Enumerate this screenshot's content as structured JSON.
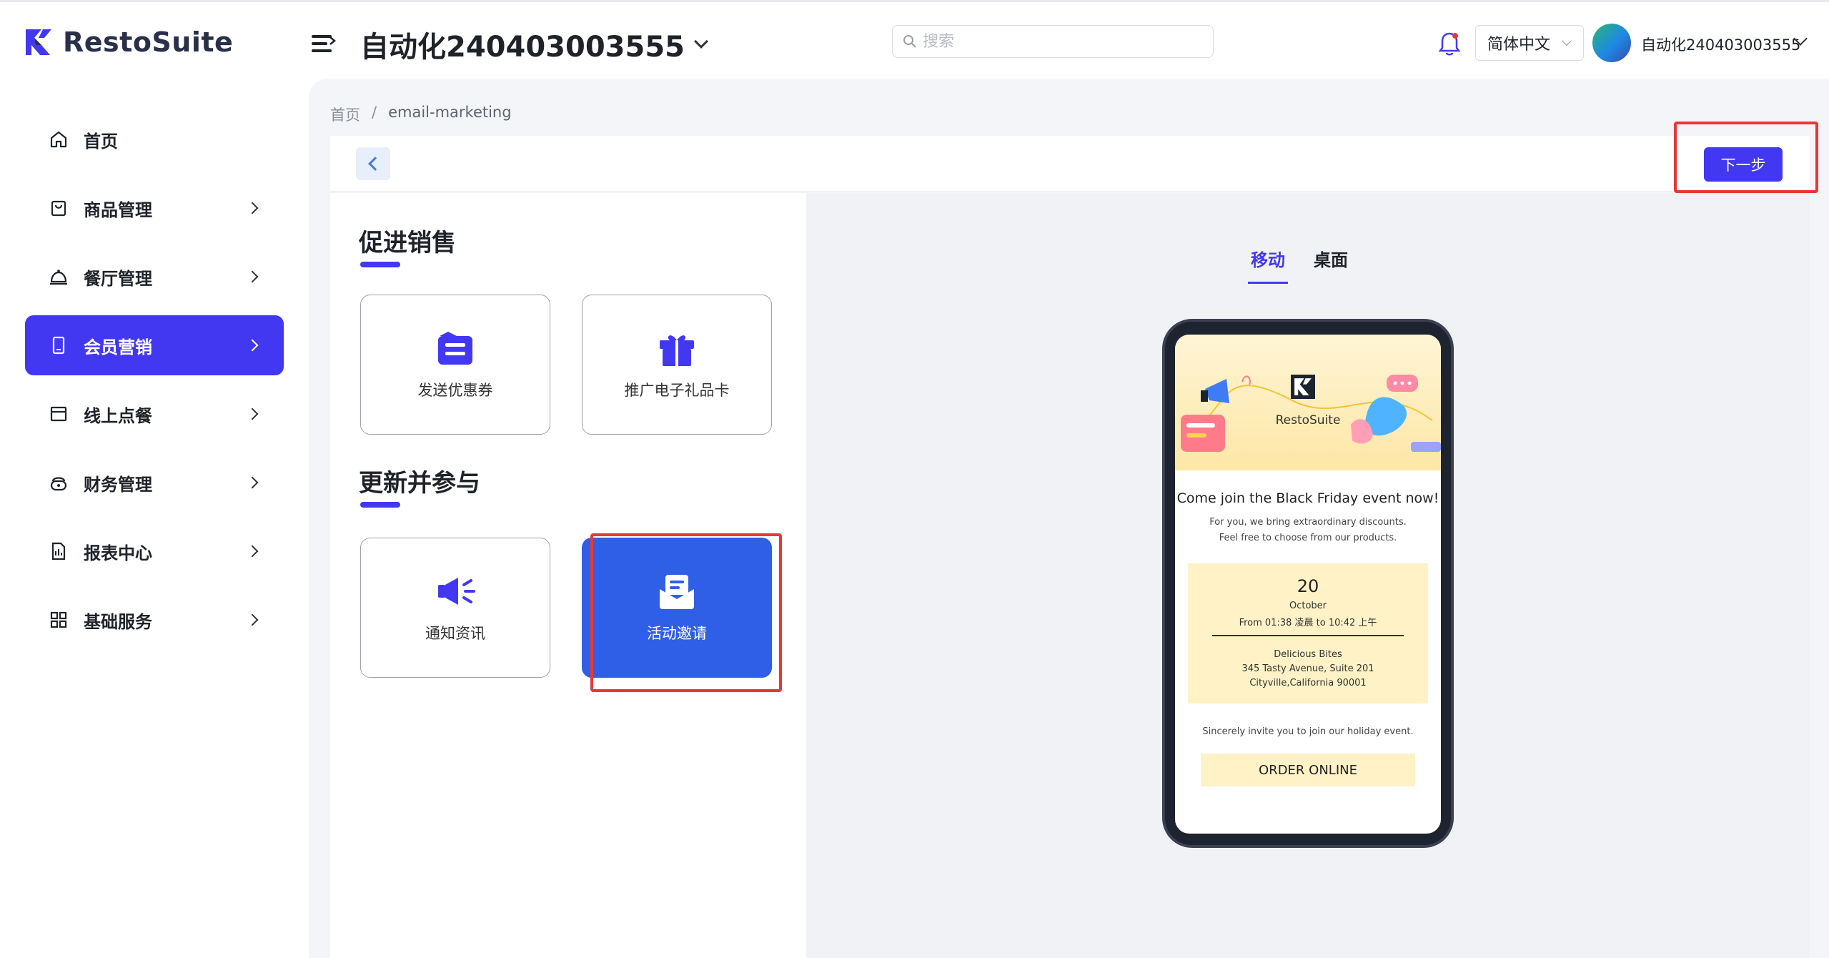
{
  "app": {
    "logo_text": "RestoSuite",
    "store_title": "自动化240403003555"
  },
  "header": {
    "search_placeholder": "搜索",
    "language": "简体中文",
    "user_name": "自动化240403003555"
  },
  "sidebar": {
    "items": [
      {
        "label": "首页",
        "icon": "home-icon"
      },
      {
        "label": "商品管理",
        "icon": "bag-icon"
      },
      {
        "label": "餐厅管理",
        "icon": "cloche-icon"
      },
      {
        "label": "会员营销",
        "icon": "phone-icon",
        "active": true
      },
      {
        "label": "线上点餐",
        "icon": "box-icon"
      },
      {
        "label": "财务管理",
        "icon": "wallet-icon"
      },
      {
        "label": "报表中心",
        "icon": "report-icon"
      },
      {
        "label": "基础服务",
        "icon": "grid-icon"
      }
    ]
  },
  "breadcrumb": {
    "home": "首页",
    "sep": "/",
    "current": "email-marketing"
  },
  "toolbar": {
    "next_label": "下一步"
  },
  "sections": [
    {
      "title": "促进销售",
      "cards": [
        {
          "label": "发送优惠券"
        },
        {
          "label": "推广电子礼品卡"
        }
      ]
    },
    {
      "title": "更新并参与",
      "cards": [
        {
          "label": "通知资讯"
        },
        {
          "label": "活动邀请",
          "selected": true
        }
      ]
    }
  ],
  "preview": {
    "tabs": [
      {
        "label": "移动",
        "active": true
      },
      {
        "label": "桌面"
      }
    ],
    "email": {
      "brand": "RestoSuite",
      "headline": "Come join the Black Friday event now!",
      "subtext": "For you, we bring extraordinary discounts. Feel free to choose from our products.",
      "event_day": "20",
      "event_month": "October",
      "event_time": "From 01:38 凌晨 to 10:42 上午",
      "place": "Delicious Bites",
      "address": "345 Tasty Avenue, Suite 201",
      "city": "Cityville,California 90001",
      "invite_text": "Sincerely invite you to join our holiday event.",
      "order_button": "ORDER ONLINE"
    }
  },
  "colors": {
    "accent": "#4338f2",
    "selected_card": "#2f5fe6",
    "highlight": "#e53935",
    "email_yellow": "#fff2c6"
  }
}
